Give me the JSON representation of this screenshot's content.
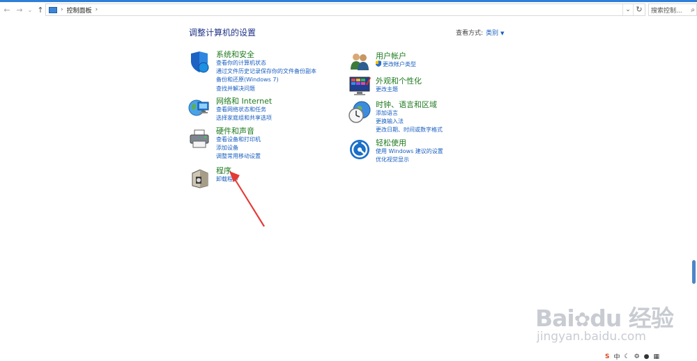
{
  "address": {
    "breadcrumb": "控制面板",
    "search_placeholder": "搜索控制..."
  },
  "header": {
    "title": "调整计算机的设置",
    "view_by_label": "查看方式:",
    "view_by_value": "类别"
  },
  "left_categories": [
    {
      "title": "系统和安全",
      "links": [
        "查看你的计算机状态",
        "通过文件历史记录保存你的文件备份副本",
        "备份和还原(Windows 7)",
        "查找并解决问题"
      ]
    },
    {
      "title": "网络和 Internet",
      "links": [
        "查看网络状态和任务",
        "选择家庭组和共享选项"
      ]
    },
    {
      "title": "硬件和声音",
      "links": [
        "查看设备和打印机",
        "添加设备",
        "调整常用移动设置"
      ]
    },
    {
      "title": "程序",
      "links": [
        "卸载程序"
      ]
    }
  ],
  "right_categories": [
    {
      "title": "用户帐户",
      "links": [
        "更改帐户类型"
      ]
    },
    {
      "title": "外观和个性化",
      "links": [
        "更改主题"
      ]
    },
    {
      "title": "时钟、语言和区域",
      "links": [
        "添加语言",
        "更换输入法",
        "更改日期、时间或数字格式"
      ]
    },
    {
      "title": "轻松使用",
      "links": [
        "使用 Windows 建议的设置",
        "优化视觉显示"
      ]
    }
  ],
  "watermark": {
    "brand": "Bai",
    "brand2": "du",
    "cn": "经验",
    "url": "jingyan.baidu.com"
  },
  "tray": {
    "ime": "S",
    "lang": "中"
  },
  "colors": {
    "accent": "#2f7fd8",
    "category_title": "#1e7a1e",
    "link": "#1a5fc2",
    "heading": "#1e3287",
    "annotation_arrow": "#e53935"
  }
}
